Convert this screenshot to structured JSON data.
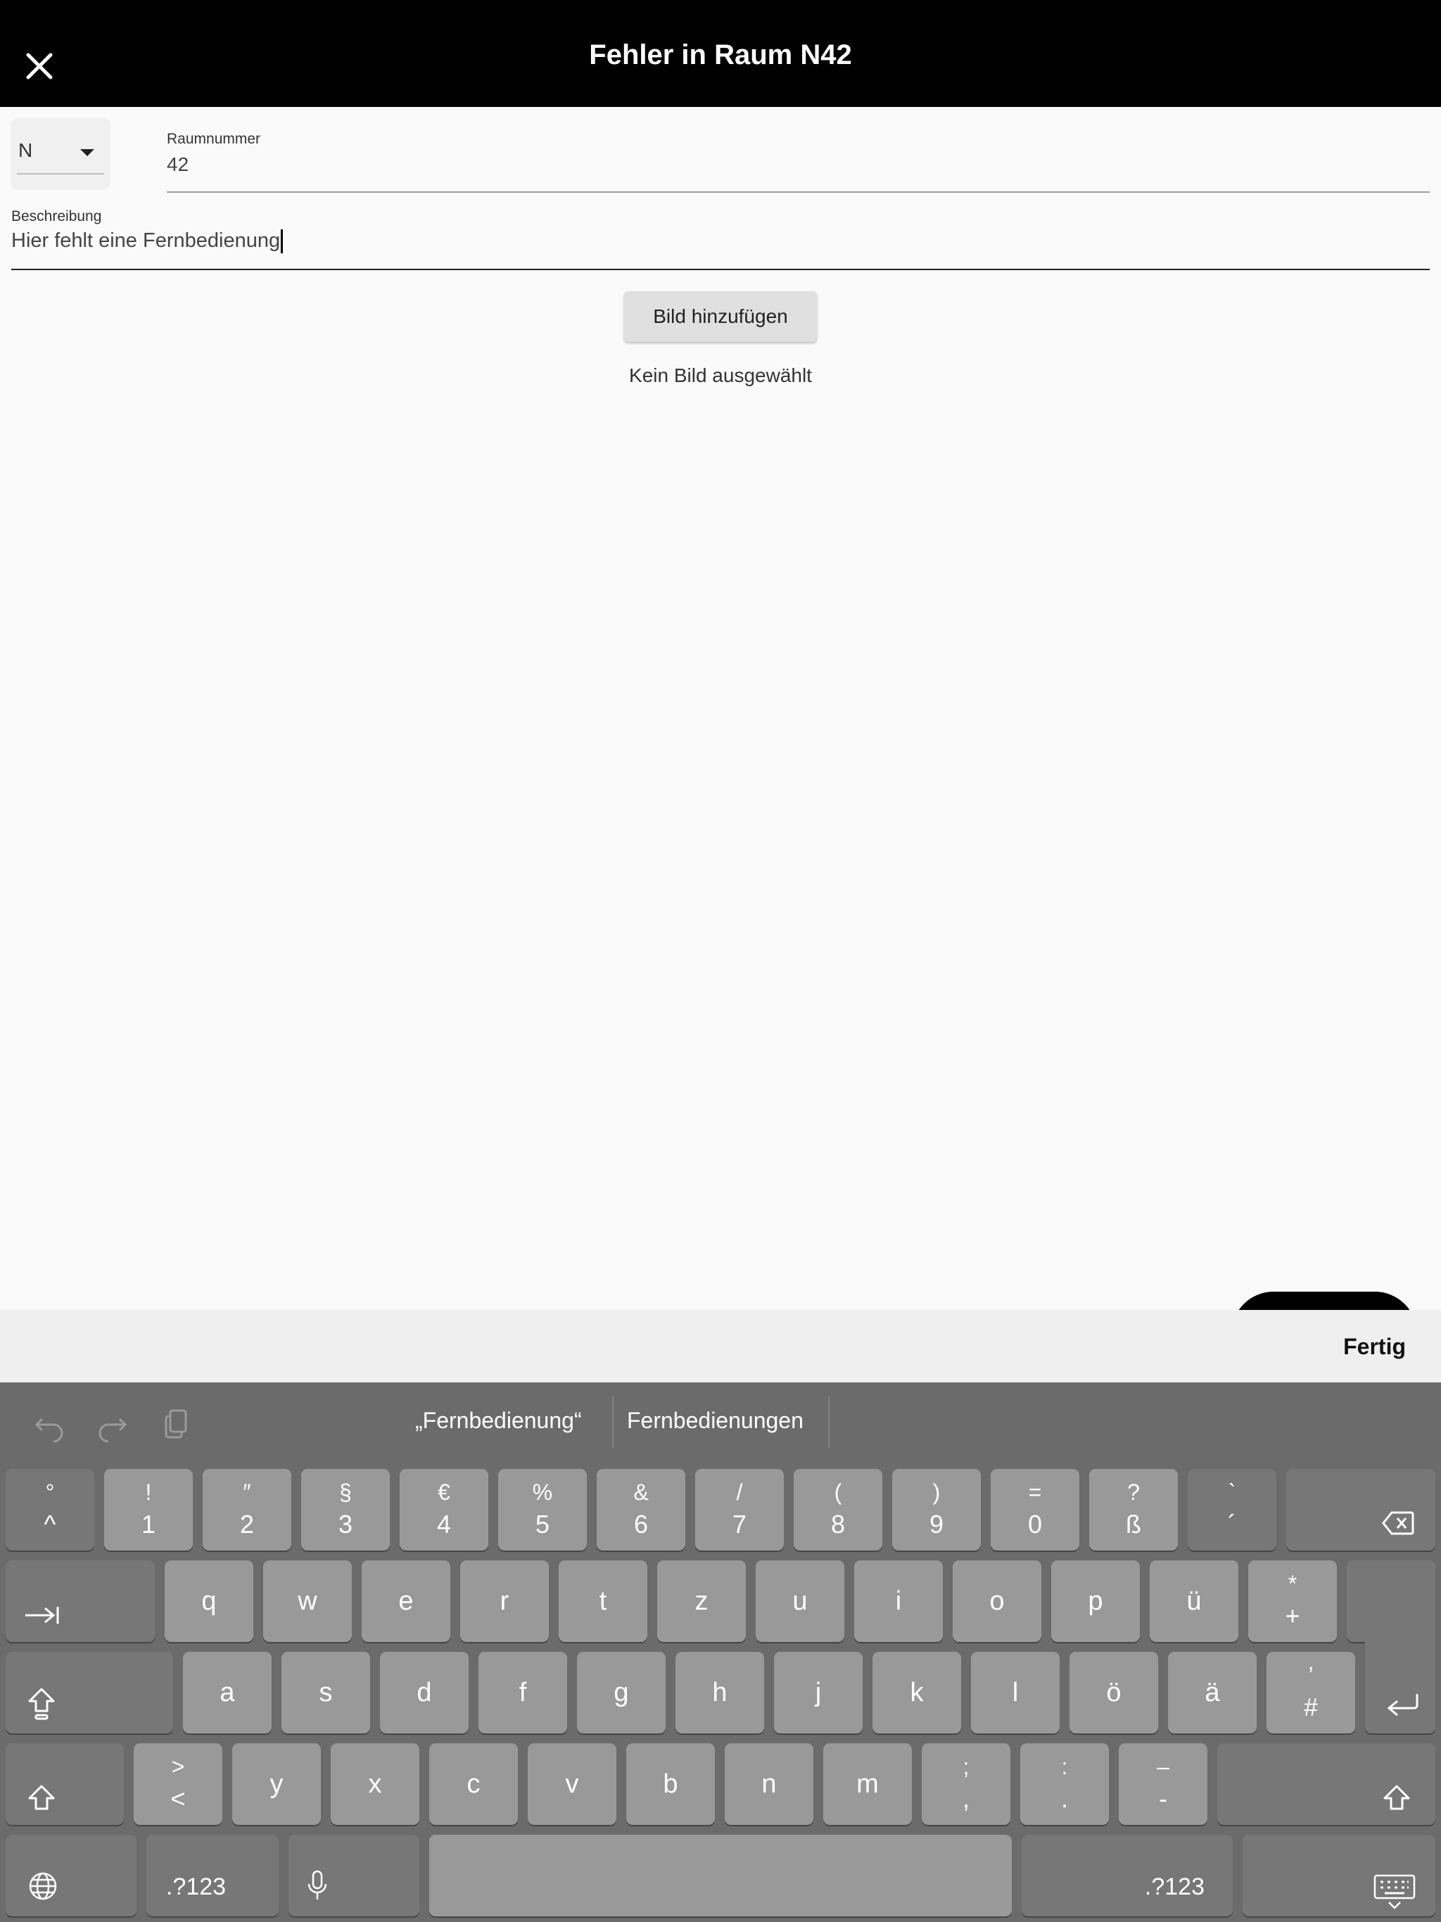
{
  "appbar": {
    "title": "Fehler in Raum N42",
    "close_icon": "close-icon"
  },
  "building_dropdown": {
    "value": "N"
  },
  "room_field": {
    "label": "Raumnummer",
    "value": "42"
  },
  "description_field": {
    "label": "Beschreibung",
    "value": "Hier fehlt eine Fernbedienung"
  },
  "add_image_button": {
    "label": "Bild hinzufügen"
  },
  "image_status": "Kein Bild ausgewählt",
  "keyboard": {
    "accessory_done": "Fertig",
    "suggestions": [
      "„Fernbedienung“",
      "Fernbedienungen"
    ],
    "number_row": [
      {
        "top": "°",
        "bottom": "^"
      },
      {
        "top": "!",
        "bottom": "1"
      },
      {
        "top": "″",
        "bottom": "2"
      },
      {
        "top": "§",
        "bottom": "3"
      },
      {
        "top": "€",
        "bottom": "4"
      },
      {
        "top": "%",
        "bottom": "5"
      },
      {
        "top": "&",
        "bottom": "6"
      },
      {
        "top": "/",
        "bottom": "7"
      },
      {
        "top": "(",
        "bottom": "8"
      },
      {
        "top": ")",
        "bottom": "9"
      },
      {
        "top": "=",
        "bottom": "0"
      },
      {
        "top": "?",
        "bottom": "ß"
      },
      {
        "top": "`",
        "bottom": "´"
      }
    ],
    "row_q": [
      "q",
      "w",
      "e",
      "r",
      "t",
      "z",
      "u",
      "i",
      "o",
      "p",
      "ü"
    ],
    "row_q_last": {
      "top": "*",
      "bottom": "+"
    },
    "row_a": [
      "a",
      "s",
      "d",
      "f",
      "g",
      "h",
      "j",
      "k",
      "l",
      "ö",
      "ä"
    ],
    "row_a_last": {
      "top": "’",
      "bottom": "#"
    },
    "row_y_first": {
      "top": ">",
      "bottom": "<"
    },
    "row_y": [
      "y",
      "x",
      "c",
      "v",
      "b",
      "n",
      "m"
    ],
    "row_y_punct": [
      {
        "top": ";",
        "bottom": ","
      },
      {
        "top": ":",
        "bottom": "."
      },
      {
        "top": "–",
        "bottom": "-"
      }
    ],
    "mode_label_left": ".?123",
    "mode_label_right": ".?123"
  }
}
